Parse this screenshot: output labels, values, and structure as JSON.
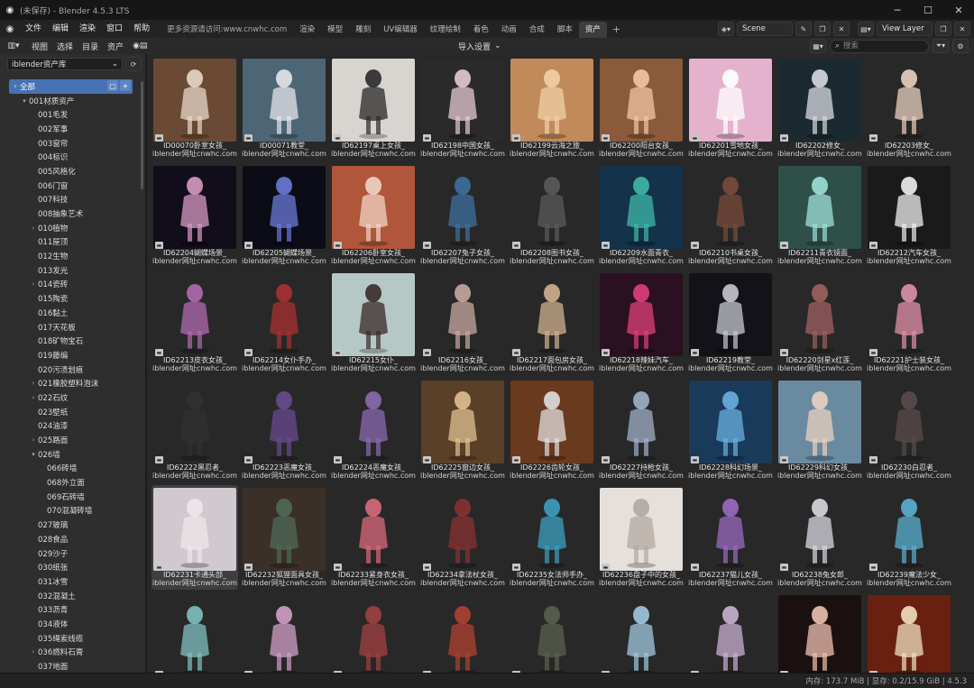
{
  "window": {
    "title": "(未保存) - Blender 4.5.3 LTS"
  },
  "menu": {
    "items": [
      "文件",
      "编辑",
      "渲染",
      "窗口",
      "帮助"
    ]
  },
  "workspaces": {
    "url_tab": "更多资源请访问:www.cnwhc.com",
    "tabs": [
      "渲染",
      "模型",
      "雕刻",
      "UV编辑器",
      "纹理绘制",
      "着色",
      "动画",
      "合成",
      "脚本",
      "资产"
    ],
    "active": "资产",
    "plus": "+"
  },
  "scene": {
    "name": "Scene",
    "view_layer": "View Layer"
  },
  "editor_header": {
    "menus": [
      "视图",
      "选择",
      "目录",
      "资产"
    ],
    "import_setting": "导入设置",
    "search_placeholder": "搜索"
  },
  "sidebar": {
    "library": "iblender资产库",
    "tree": [
      {
        "label": "全部",
        "indent": 0,
        "arrow": "▾",
        "selected": true
      },
      {
        "label": "001材质资产",
        "indent": 1,
        "arrow": "▾"
      },
      {
        "label": "001毛发",
        "indent": 2,
        "arrow": ""
      },
      {
        "label": "002军事",
        "indent": 2,
        "arrow": ""
      },
      {
        "label": "003窗帘",
        "indent": 2,
        "arrow": ""
      },
      {
        "label": "004标识",
        "indent": 2,
        "arrow": ""
      },
      {
        "label": "005风格化",
        "indent": 2,
        "arrow": ""
      },
      {
        "label": "006门窗",
        "indent": 2,
        "arrow": ""
      },
      {
        "label": "007科技",
        "indent": 2,
        "arrow": ""
      },
      {
        "label": "008抽象艺术",
        "indent": 2,
        "arrow": ""
      },
      {
        "label": "010植物",
        "indent": 2,
        "arrow": "›"
      },
      {
        "label": "011屋顶",
        "indent": 2,
        "arrow": ""
      },
      {
        "label": "012生物",
        "indent": 2,
        "arrow": ""
      },
      {
        "label": "013发光",
        "indent": 2,
        "arrow": ""
      },
      {
        "label": "014瓷砖",
        "indent": 2,
        "arrow": "›"
      },
      {
        "label": "015陶瓷",
        "indent": 2,
        "arrow": ""
      },
      {
        "label": "016黏土",
        "indent": 2,
        "arrow": ""
      },
      {
        "label": "017天花板",
        "indent": 2,
        "arrow": ""
      },
      {
        "label": "018矿物宝石",
        "indent": 2,
        "arrow": ""
      },
      {
        "label": "019藤编",
        "indent": 2,
        "arrow": ""
      },
      {
        "label": "020污渍划痕",
        "indent": 2,
        "arrow": ""
      },
      {
        "label": "021橡胶塑料泡沫",
        "indent": 2,
        "arrow": "›"
      },
      {
        "label": "022石纹",
        "indent": 2,
        "arrow": "›"
      },
      {
        "label": "023壁纸",
        "indent": 2,
        "arrow": ""
      },
      {
        "label": "024油漆",
        "indent": 2,
        "arrow": ""
      },
      {
        "label": "025路面",
        "indent": 2,
        "arrow": "›"
      },
      {
        "label": "026墙",
        "indent": 2,
        "arrow": "▾"
      },
      {
        "label": "066砖墙",
        "indent": 3,
        "arrow": ""
      },
      {
        "label": "068外立面",
        "indent": 3,
        "arrow": ""
      },
      {
        "label": "069石砖墙",
        "indent": 3,
        "arrow": ""
      },
      {
        "label": "070混凝砖墙",
        "indent": 3,
        "arrow": ""
      },
      {
        "label": "027玻璃",
        "indent": 2,
        "arrow": ""
      },
      {
        "label": "028食品",
        "indent": 2,
        "arrow": ""
      },
      {
        "label": "029沙子",
        "indent": 2,
        "arrow": ""
      },
      {
        "label": "030纸张",
        "indent": 2,
        "arrow": ""
      },
      {
        "label": "031冰雪",
        "indent": 2,
        "arrow": ""
      },
      {
        "label": "032混凝土",
        "indent": 2,
        "arrow": ""
      },
      {
        "label": "033沥青",
        "indent": 2,
        "arrow": ""
      },
      {
        "label": "034液体",
        "indent": 2,
        "arrow": ""
      },
      {
        "label": "035绳索线缆",
        "indent": 2,
        "arrow": ""
      },
      {
        "label": "036燃料石膏",
        "indent": 2,
        "arrow": "›"
      },
      {
        "label": "037地面",
        "indent": 2,
        "arrow": ""
      }
    ]
  },
  "assets": [
    {
      "name": "ID00070卧室女孩_",
      "sub": "iblender网址cnwhc.com",
      "bg": "#6b4a35",
      "fig": "#e8d8c8"
    },
    {
      "name": "ID00071教堂_",
      "sub": "iblender网址cnwhc.com",
      "bg": "#4d6676",
      "fig": "#e6e6ea"
    },
    {
      "name": "ID62197桌上女孩_",
      "sub": "iblender网址cnwhc.com",
      "bg": "#d8d4d0",
      "fig": "#2a2a2a"
    },
    {
      "name": "ID62198中国女孩_",
      "sub": "iblender网址cnwhc.com",
      "bg": "#2a2a2a",
      "fig": "#e6c9d6"
    },
    {
      "name": "ID62199云海之旅_",
      "sub": "iblender网址cnwhc.com",
      "bg": "#c08a5a",
      "fig": "#f1d0a8"
    },
    {
      "name": "ID62200阳台女孩_",
      "sub": "iblender网址cnwhc.com",
      "bg": "#8a5a3a",
      "fig": "#f2c6a2"
    },
    {
      "name": "ID62201雪地女孩_",
      "sub": "iblender网址cnwhc.com",
      "bg": "#e4b2cc",
      "fig": "#ffffff"
    },
    {
      "name": "ID62202修女_",
      "sub": "iblender网址cnwhc.com",
      "bg": "#1b2a30",
      "fig": "#d9d9e0"
    },
    {
      "name": "ID62203修女_",
      "sub": "iblender网址cnwhc.com",
      "bg": "#282828",
      "fig": "#e9d0c0"
    },
    {
      "name": "ID62204蝴蝶场景_",
      "sub": "iblender网址cnwhc.com",
      "bg": "#120d1a",
      "fig": "#d89ac4"
    },
    {
      "name": "ID62205蝴蝶场景_",
      "sub": "iblender网址cnwhc.com",
      "bg": "#0c0c16",
      "fig": "#6a7ad8"
    },
    {
      "name": "ID62206卧室女孩_",
      "sub": "iblender网址cnwhc.com",
      "bg": "#b0563a",
      "fig": "#f0d4c4"
    },
    {
      "name": "ID62207兔子女孩_",
      "sub": "iblender网址cnwhc.com",
      "bg": "#282828",
      "fig": "#3f6f9e"
    },
    {
      "name": "ID62208图书女孩_",
      "sub": "iblender网址cnwhc.com",
      "bg": "#282828",
      "fig": "#5a5a5a"
    },
    {
      "name": "ID62209水面青衣_",
      "sub": "iblender网址cnwhc.com",
      "bg": "#14324a",
      "fig": "#3fb8a8"
    },
    {
      "name": "ID62210书桌女孩_",
      "sub": "iblender网址cnwhc.com",
      "bg": "#282828",
      "fig": "#7a4a3a"
    },
    {
      "name": "ID62211青衣镜面_",
      "sub": "iblender网址cnwhc.com",
      "bg": "#2e5048",
      "fig": "#9fe0d8"
    },
    {
      "name": "ID62212汽车女孩_",
      "sub": "iblender网址cnwhc.com",
      "bg": "#1a1a1a",
      "fig": "#f0f0f0"
    },
    {
      "name": "ID62213皮衣女孩_",
      "sub": "iblender网址cnwhc.com",
      "bg": "#282828",
      "fig": "#b06ab0"
    },
    {
      "name": "ID62214女仆手办_",
      "sub": "iblender网址cnwhc.com",
      "bg": "#282828",
      "fig": "#a83030"
    },
    {
      "name": "ID62215女仆_",
      "sub": "iblender网址cnwhc.com",
      "bg": "#b6c8c6",
      "fig": "#3a2a2a"
    },
    {
      "name": "ID62216女孩_",
      "sub": "iblender网址cnwhc.com",
      "bg": "#282828",
      "fig": "#c8a8a0"
    },
    {
      "name": "ID62217面包房女孩_",
      "sub": "iblender网址cnwhc.com",
      "bg": "#282828",
      "fig": "#d0b090"
    },
    {
      "name": "ID62218辣妹汽车_",
      "sub": "iblender网址cnwhc.com",
      "bg": "#2a1020",
      "fig": "#e0407a"
    },
    {
      "name": "ID62219教堂_",
      "sub": "iblender网址cnwhc.com",
      "bg": "#121218",
      "fig": "#c8c8d0"
    },
    {
      "name": "ID62220剑星x红莲_",
      "sub": "iblender网址cnwhc.com",
      "bg": "#282828",
      "fig": "#a06060"
    },
    {
      "name": "ID62221护士装女孩_",
      "sub": "iblender网址cnwhc.com",
      "bg": "#282828",
      "fig": "#e090a8"
    },
    {
      "name": "ID62222黑忍者_",
      "sub": "iblender网址cnwhc.com",
      "bg": "#282828",
      "fig": "#303030"
    },
    {
      "name": "ID62223恶魔女孩_",
      "sub": "iblender网址cnwhc.com",
      "bg": "#282828",
      "fig": "#6a4a90"
    },
    {
      "name": "ID62224恶魔女孩_",
      "sub": "iblender网址cnwhc.com",
      "bg": "#282828",
      "fig": "#8a6ab0"
    },
    {
      "name": "ID62225窗边女孩_",
      "sub": "iblender网址cnwhc.com",
      "bg": "#5a4028",
      "fig": "#e0c090"
    },
    {
      "name": "ID62226齿轮女孩_",
      "sub": "iblender网址cnwhc.com",
      "bg": "#6a3a1e",
      "fig": "#e0e0e0"
    },
    {
      "name": "ID62227持枪女孩_",
      "sub": "iblender网址cnwhc.com",
      "bg": "#282828",
      "fig": "#a0b0c8"
    },
    {
      "name": "ID62228科幻场景_",
      "sub": "iblender网址cnwhc.com",
      "bg": "#1a3a5a",
      "fig": "#6ab0e0"
    },
    {
      "name": "ID62229科幻女孩_",
      "sub": "iblender网址cnwhc.com",
      "bg": "#6a8aa0",
      "fig": "#e8d0c0"
    },
    {
      "name": "ID62230白忍者_",
      "sub": "iblender网址cnwhc.com",
      "bg": "#282828",
      "fig": "#5a4a4a"
    },
    {
      "name": "ID62231卡通头部_",
      "sub": "iblender网址cnwhc.com",
      "bg": "#d0cad0",
      "fig": "#f0e6ea",
      "active": true
    },
    {
      "name": "ID62232狐狸面具女孩_",
      "sub": "iblender网址cnwhc.com",
      "bg": "#3a3028",
      "fig": "#506a5a"
    },
    {
      "name": "ID62233紧身衣女孩_",
      "sub": "iblender网址cnwhc.com",
      "bg": "#282828",
      "fig": "#d86a7a"
    },
    {
      "name": "ID62234拿法杖女孩_",
      "sub": "iblender网址cnwhc.com",
      "bg": "#282828",
      "fig": "#8a3030"
    },
    {
      "name": "ID62235女法师手办_",
      "sub": "iblender网址cnwhc.com",
      "bg": "#282828",
      "fig": "#3aa0c0"
    },
    {
      "name": "ID62236盘子中的女孩_",
      "sub": "iblender网址cnwhc.com",
      "bg": "#e6e0dc",
      "fig": "#b0a8a0"
    },
    {
      "name": "ID62237猫儿女孩_",
      "sub": "iblender网址cnwhc.com",
      "bg": "#282828",
      "fig": "#9a6ac0"
    },
    {
      "name": "ID62238兔女郎_",
      "sub": "iblender网址cnwhc.com",
      "bg": "#282828",
      "fig": "#d8d8e0"
    },
    {
      "name": "ID62239魔法少女_",
      "sub": "iblender网址cnwhc.com",
      "bg": "#282828",
      "fig": "#5ab0d0"
    },
    {
      "name": "",
      "sub": "",
      "bg": "#282828",
      "fig": "#80c0c0"
    },
    {
      "name": "",
      "sub": "",
      "bg": "#282828",
      "fig": "#d0a0c8"
    },
    {
      "name": "",
      "sub": "",
      "bg": "#282828",
      "fig": "#a04040"
    },
    {
      "name": "",
      "sub": "",
      "bg": "#282828",
      "fig": "#b04030"
    },
    {
      "name": "",
      "sub": "",
      "bg": "#282828",
      "fig": "#5a6050"
    },
    {
      "name": "",
      "sub": "",
      "bg": "#282828",
      "fig": "#a0c8e0"
    },
    {
      "name": "",
      "sub": "",
      "bg": "#282828",
      "fig": "#c8b0d0"
    },
    {
      "name": "",
      "sub": "",
      "bg": "#1a1010",
      "fig": "#f0c0b0"
    },
    {
      "name": "",
      "sub": "",
      "bg": "#6a2010",
      "fig": "#f0e0c0"
    }
  ],
  "status": {
    "stats": "内存: 173.7 MiB | 显存: 0.2/15.9 GiB | 4.5.3"
  },
  "colors": {
    "accent": "#4772b3",
    "panel": "#2e2e2e",
    "grid_bg": "#282828"
  }
}
